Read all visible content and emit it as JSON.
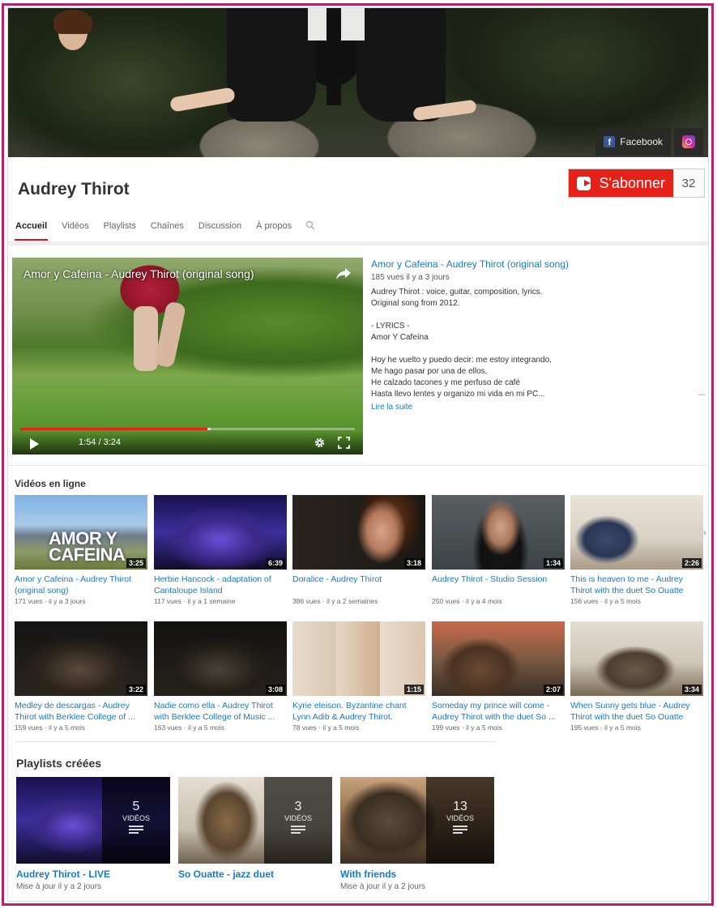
{
  "channel": {
    "name": "Audrey Thirot",
    "subscribe_label": "S'abonner",
    "subscriber_count": "32",
    "social": [
      {
        "label": "Facebook",
        "icon": "facebook-icon"
      },
      {
        "label": "",
        "icon": "instagram-icon"
      }
    ]
  },
  "tabs": [
    "Accueil",
    "Vidéos",
    "Playlists",
    "Chaînes",
    "Discussion",
    "À propos"
  ],
  "featured": {
    "player_title": "Amor y Cafeina - Audrey Thirot (original song)",
    "time": "1:54 / 3:24",
    "progress": 0.56,
    "buffered": 0.57,
    "title": "Amor y Cafeina - Audrey Thirot (original song)",
    "meta": "185 vues  il y a 3 jours",
    "description": "Audrey Thirot : voice, guitar, composition, lyrics.\nOriginal song from 2012.\n\n- LYRICS -\nAmor Y Cafeína\n\nHoy he vuelto y puedo decir: me estoy integrando,\nMe hago pasar por una de ellos,\nHe calzado tacones y me perfuso de café\nHasta llevo lentes y organizo mi vida en mi PC...",
    "read_more": "Lire la suite",
    "ellipsis": "..."
  },
  "videos_section": {
    "title": "Vidéos en ligne",
    "rows": [
      [
        {
          "title": "Amor y Cafeina - Audrey Thirot (original song)",
          "meta": "171 vues · il y a 3 jours",
          "duration": "3:25",
          "overlay": "AMOR Y\nCAFEINA",
          "bg": "linear-gradient(180deg,#7fb3e3 0%,#a8c9e8 40%,#6e7b8a 55%,#8d9a6a 75%,#6b7a3a 100%)"
        },
        {
          "title": "Herbie Hancock - adaptation of Cantaloupe Island",
          "meta": "117 vues · il y a 1 semaine",
          "duration": "6:39",
          "bg": "radial-gradient(ellipse 70px 40px at 82px 55px,#6a4fd8 0%,#3c2a8a 60%,transparent 100%),linear-gradient(180deg,#1a1050 0%,#3b2f9a 50%,#120c2c 100%)"
        },
        {
          "title": "Doralice - Audrey Thirot",
          "meta": "386 vues · il y a 2 semaines",
          "duration": "3:18",
          "bg": "radial-gradient(ellipse 30px 40px at 110px 45px,#d8a58a 0%,#b47a5c 60%,transparent 100%),radial-gradient(ellipse 40px 50px at 120px 30px,#6b3a1e 0%,#3a1e0f 70%,transparent 100%),linear-gradient(90deg,#2a2420 0%,#1a1714 100%)"
        },
        {
          "title": "Audrey Thirot - Studio Session",
          "meta": "250 vues · il y a 4 mois",
          "duration": "1:34",
          "bg": "radial-gradient(ellipse 25px 35px at 85px 40px,#d1a48a 0%,#a9775c 60%,transparent 100%),radial-gradient(ellipse 35px 60px at 85px 70px,#151515 0%,#111 70%,transparent 100%),linear-gradient(180deg,#5a5f62 0%,#3d4245 100%)"
        },
        {
          "title": "This is heaven to me - Audrey Thirot with the duet So Ouatte",
          "meta": "156 vues · il y a 5 mois",
          "duration": "2:26",
          "bg": "radial-gradient(ellipse 40px 30px at 45px 55px,#3a4a6a 0%,#2a3656 70%,transparent 100%),linear-gradient(180deg,#e9e3d8 0%,#d8d0c2 60%,#a89a86 100%)"
        }
      ],
      [
        {
          "title": "Medley de descargas - Audrey Thirot with Berklee College of ...",
          "meta": "159 vues · il y a 5 mois",
          "duration": "3:22",
          "bg": "radial-gradient(ellipse 70px 40px at 80px 60px,#5a4a3a 0%,#2b241c 70%,transparent 100%),linear-gradient(180deg,#141414 0%,#2a2520 100%)"
        },
        {
          "title": "Nadie como ella - Audrey Thirot with Berklee College of Music ...",
          "meta": "163 vues · il y a 5 mois",
          "duration": "3:08",
          "bg": "radial-gradient(ellipse 70px 40px at 80px 60px,#4a4236 0%,#221e18 70%,transparent 100%),linear-gradient(180deg,#121212 0%,#26221d 100%)"
        },
        {
          "title": "Kyrie eleison. Byzantine chant Lynn Adib & Audrey Thirot.",
          "meta": "78 vues · il y a 5 mois",
          "duration": "1:15",
          "bg": "linear-gradient(90deg,#e8dccd 0%,#d9c7b2 33%,#e6d6c4 33%,#cfae8f 66%,#e9ddd0 66%,#dcc6ae 100%)"
        },
        {
          "title": "Someday my prince will come - Audrey Thirot with the duet So ...",
          "meta": "199 vues · il y a 5 mois",
          "duration": "2:07",
          "bg": "radial-gradient(ellipse 50px 40px at 60px 60px,#6a4a32 0%,#4a3222 70%,transparent 100%),linear-gradient(180deg,#c96a4a 0%,#7a5a44 50%,#3a2e26 100%)"
        },
        {
          "title": "When Sunny gets blue - Audrey Thirot with the duet So Ouatte",
          "meta": "195 vues · il y a 5 mois",
          "duration": "3:34",
          "bg": "radial-gradient(ellipse 50px 30px at 80px 60px,#6b5a48 0%,#4b3d30 70%,transparent 100%),linear-gradient(180deg,#e3ddd2 0%,#cfc6b6 55%,#7a6a58 100%)"
        }
      ]
    ]
  },
  "playlists_section": {
    "title": "Playlists créées",
    "items": [
      {
        "title": "Audrey Thirot - LIVE",
        "meta": "Mise à jour il y a 2 jours",
        "count": "5",
        "count_label": "VIDÉOS",
        "bg": "radial-gradient(ellipse 60px 35px at 70px 60px,#6a4fd8 0%,#3c2a8a 60%,transparent 100%),linear-gradient(180deg,#1a1050 0%,#3b2f9a 50%,#120c2c 100%)"
      },
      {
        "title": "So Ouatte - jazz duet",
        "meta": "",
        "count": "3",
        "count_label": "VIDÉOS",
        "bg": "radial-gradient(ellipse 40px 50px at 60px 55px,#8a6a4a 0%,#5a4530 70%,transparent 100%),linear-gradient(180deg,#e5ded2 0%,#c9bfae 60%,#6e624f 100%)"
      },
      {
        "title": "With friends",
        "meta": "Mise à jour il y a 2 jours",
        "count": "13",
        "count_label": "VIDÉOS",
        "bg": "radial-gradient(ellipse 60px 50px at 60px 55px,#5a4a3a 0%,#3a2e22 70%,transparent 100%),linear-gradient(180deg,#c8a27a 0%,#8a6a4a 50%,#3a2e22 100%)"
      }
    ]
  }
}
